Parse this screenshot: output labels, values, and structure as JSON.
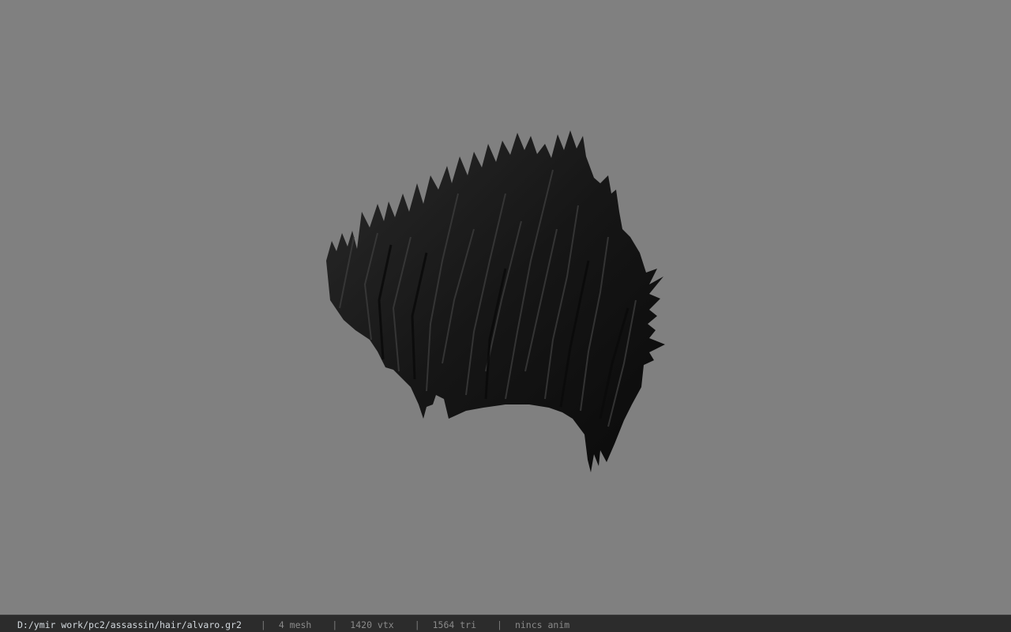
{
  "viewer": {
    "background_color": "#808080",
    "model_color": "#151515",
    "model_name": "hair-mesh"
  },
  "status": {
    "file_path": "D:/ymir work/pc2/assassin/hair/alvaro.gr2",
    "separator": "|",
    "mesh_count": "4 mesh",
    "vertex_count": "1420 vtx",
    "triangle_count": "1564 tri",
    "anim_status": "nincs anim"
  }
}
